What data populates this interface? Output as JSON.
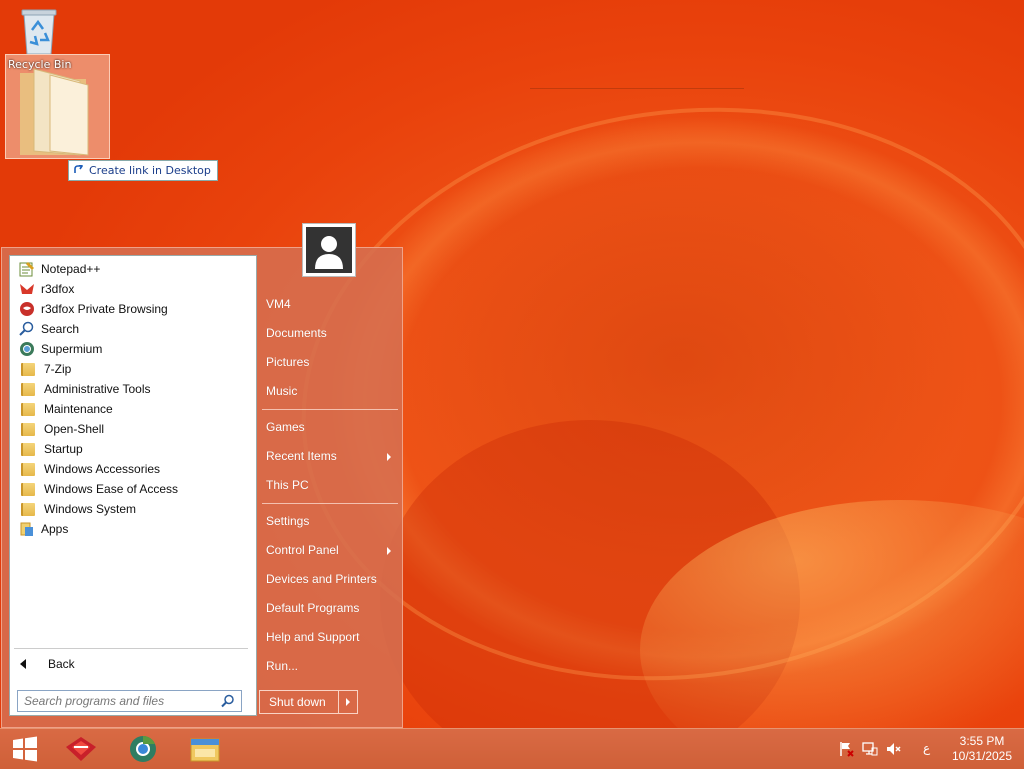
{
  "desktop": {
    "icons": [
      {
        "label": "Recycle Bin",
        "icon": "recycle-bin-icon"
      }
    ],
    "drag_tooltip": "Create link in Desktop"
  },
  "start_menu": {
    "programs": [
      {
        "label": "Notepad++",
        "icon": "notepad-plus-icon"
      },
      {
        "label": "r3dfox",
        "icon": "r3dfox-icon"
      },
      {
        "label": "r3dfox Private Browsing",
        "icon": "r3dfox-private-icon"
      },
      {
        "label": "Search",
        "icon": "search-icon"
      },
      {
        "label": "Supermium",
        "icon": "supermium-icon"
      },
      {
        "label": "7-Zip",
        "icon": "folder-icon"
      },
      {
        "label": "Administrative Tools",
        "icon": "folder-icon"
      },
      {
        "label": "Maintenance",
        "icon": "folder-icon"
      },
      {
        "label": "Open-Shell",
        "icon": "folder-icon"
      },
      {
        "label": "Startup",
        "icon": "folder-icon"
      },
      {
        "label": "Windows Accessories",
        "icon": "folder-icon"
      },
      {
        "label": "Windows Ease of Access",
        "icon": "folder-icon"
      },
      {
        "label": "Windows System",
        "icon": "folder-icon"
      },
      {
        "label": "Apps",
        "icon": "apps-icon"
      }
    ],
    "back_label": "Back",
    "search_placeholder": "Search programs and files",
    "right_items": [
      {
        "label": "VM4",
        "submenu": false
      },
      {
        "label": "Documents",
        "submenu": false
      },
      {
        "label": "Pictures",
        "submenu": false
      },
      {
        "label": "Music",
        "submenu": false
      },
      {
        "label": "Games",
        "submenu": false
      },
      {
        "label": "Recent Items",
        "submenu": true
      },
      {
        "label": "This PC",
        "submenu": false
      },
      {
        "label": "Settings",
        "submenu": false
      },
      {
        "label": "Control Panel",
        "submenu": true
      },
      {
        "label": "Devices and Printers",
        "submenu": false
      },
      {
        "label": "Default Programs",
        "submenu": false
      },
      {
        "label": "Help and Support",
        "submenu": false
      },
      {
        "label": "Run...",
        "submenu": false
      }
    ],
    "shutdown_label": "Shut down"
  },
  "taskbar": {
    "pinned": [
      "start-button",
      "app-icon",
      "browser-icon",
      "file-explorer-icon"
    ],
    "tray": {
      "icons": [
        "action-center-icon",
        "network-icon",
        "volume-muted-icon"
      ],
      "language": "ع",
      "time": "3:55 PM",
      "date": "10/31/2025"
    }
  },
  "colors": {
    "accent": "#e8400c",
    "menu_bg": "#d66e50",
    "taskbar": "#d3643c"
  }
}
